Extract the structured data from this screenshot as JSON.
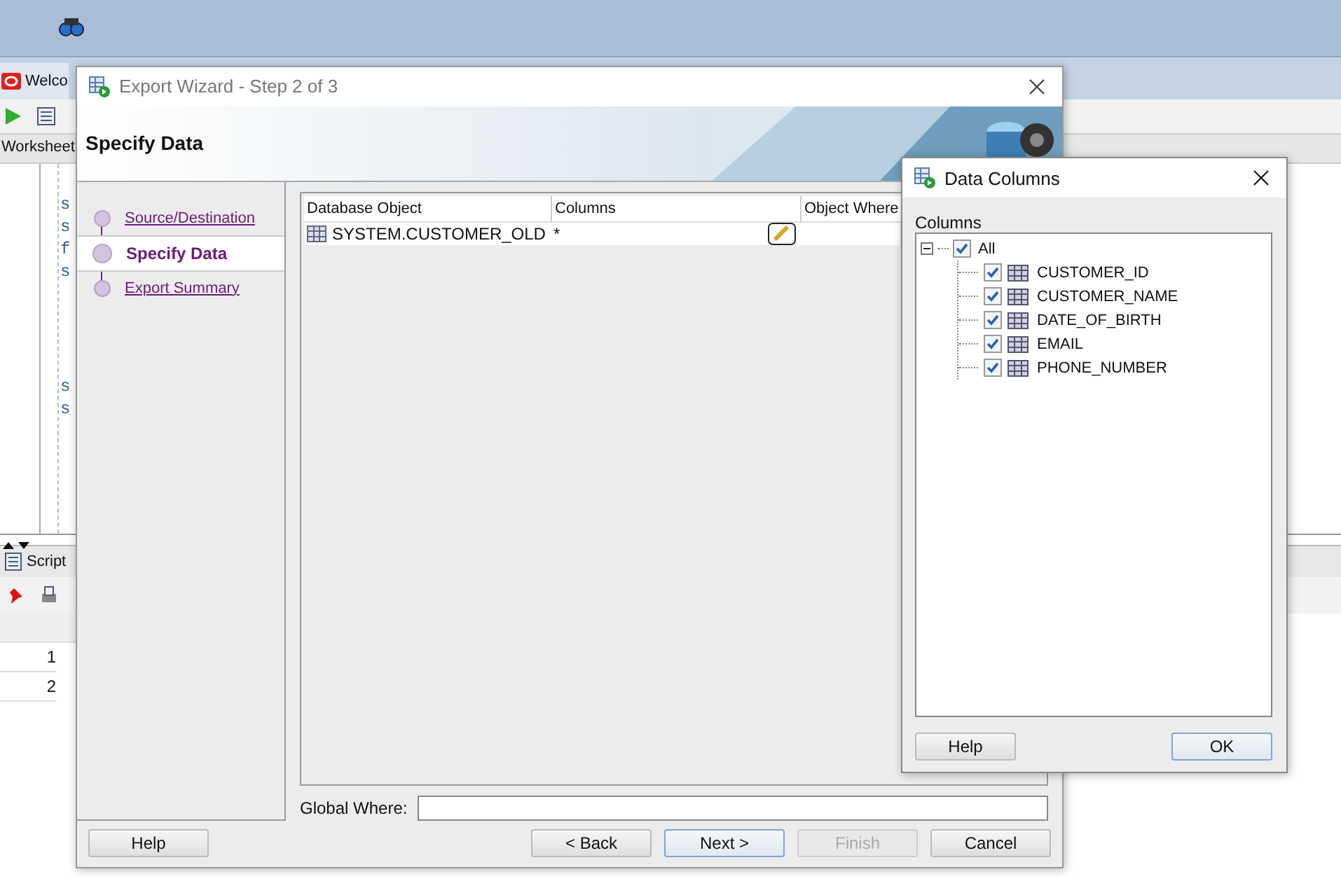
{
  "ide": {
    "editor_tab": "Welco",
    "worksheet_tab": "Worksheet",
    "code_blocks": [
      [
        "s",
        "s",
        "f",
        "s"
      ],
      [
        "s",
        "s"
      ]
    ],
    "output_tab": "Script",
    "row_numbers": [
      "1",
      "2"
    ]
  },
  "wizard": {
    "title": "Export Wizard - Step 2 of 3",
    "header": "Specify Data",
    "steps": [
      {
        "label": "Source/Destination",
        "selected": false
      },
      {
        "label": "Specify Data",
        "selected": true
      },
      {
        "label": "Export Summary",
        "selected": false
      }
    ],
    "table": {
      "columns": [
        "Database Object",
        "Columns",
        "Object Where"
      ],
      "rows": [
        {
          "object": "SYSTEM.CUSTOMER_OLD",
          "columns": "*"
        }
      ]
    },
    "global_where": {
      "label": "Global Where:"
    },
    "help_button": {
      "label": "Help"
    },
    "buttons": [
      {
        "label": "< Back",
        "disabled": false,
        "default": false
      },
      {
        "label": "Next >",
        "disabled": false,
        "default": true
      },
      {
        "label": "Finish",
        "disabled": true,
        "default": false
      },
      {
        "label": "Cancel",
        "disabled": false,
        "default": false
      }
    ]
  },
  "data_columns": {
    "title": "Data Columns",
    "label": "Columns",
    "root": {
      "label": "All",
      "checked": true,
      "expanded": true,
      "children": [
        {
          "label": "CUSTOMER_ID",
          "checked": true
        },
        {
          "label": "CUSTOMER_NAME",
          "checked": true
        },
        {
          "label": "DATE_OF_BIRTH",
          "checked": true
        },
        {
          "label": "EMAIL",
          "checked": true
        },
        {
          "label": "PHONE_NUMBER",
          "checked": true
        }
      ]
    },
    "help_button": {
      "label": "Help"
    },
    "ok_button": {
      "label": "OK",
      "default": true
    }
  }
}
